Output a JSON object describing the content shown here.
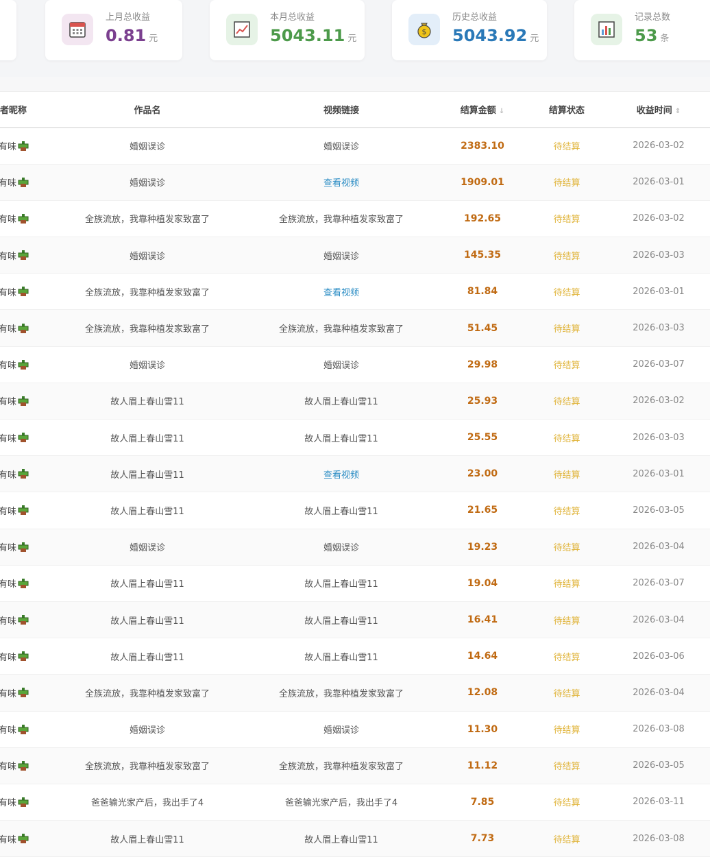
{
  "stats": [
    {
      "label": "上月总收益",
      "value": "0.81",
      "unit": "元",
      "color": "#7b3f8f",
      "icon": "calendar-icon",
      "icon_bg": "#f3e6f1"
    },
    {
      "label": "本月总收益",
      "value": "5043.11",
      "unit": "元",
      "color": "#4c9a4a",
      "icon": "trend-chart-icon",
      "icon_bg": "#e6f3e6"
    },
    {
      "label": "历史总收益",
      "value": "5043.92",
      "unit": "元",
      "color": "#2a79b8",
      "icon": "money-bag-icon",
      "icon_bg": "#e3eef9"
    },
    {
      "label": "记录总数",
      "value": "53",
      "unit": "条",
      "color": "#4c9a4a",
      "icon": "bar-chart-icon",
      "icon_bg": "#e6f3e6"
    }
  ],
  "table": {
    "headers": {
      "nickname": "者昵称",
      "work": "作品名",
      "video": "视频链接",
      "amount": "结算金额",
      "amount_sort": "↓",
      "status": "结算状态",
      "time": "收益时间",
      "time_sort": "⇕"
    },
    "rows": [
      {
        "nick": "有味",
        "work": "婚姻误诊",
        "video": "婚姻误诊",
        "video_is_link": false,
        "amount": "2383.10",
        "status": "待结算",
        "date": "2026-03-02"
      },
      {
        "nick": "有味",
        "work": "婚姻误诊",
        "video": "查看视频",
        "video_is_link": true,
        "amount": "1909.01",
        "status": "待结算",
        "date": "2026-03-01"
      },
      {
        "nick": "有味",
        "work": "全族流放，我靠种植发家致富了",
        "video": "全族流放，我靠种植发家致富了",
        "video_is_link": false,
        "amount": "192.65",
        "status": "待结算",
        "date": "2026-03-02"
      },
      {
        "nick": "有味",
        "work": "婚姻误诊",
        "video": "婚姻误诊",
        "video_is_link": false,
        "amount": "145.35",
        "status": "待结算",
        "date": "2026-03-03"
      },
      {
        "nick": "有味",
        "work": "全族流放，我靠种植发家致富了",
        "video": "查看视频",
        "video_is_link": true,
        "amount": "81.84",
        "status": "待结算",
        "date": "2026-03-01"
      },
      {
        "nick": "有味",
        "work": "全族流放，我靠种植发家致富了",
        "video": "全族流放，我靠种植发家致富了",
        "video_is_link": false,
        "amount": "51.45",
        "status": "待结算",
        "date": "2026-03-03"
      },
      {
        "nick": "有味",
        "work": "婚姻误诊",
        "video": "婚姻误诊",
        "video_is_link": false,
        "amount": "29.98",
        "status": "待结算",
        "date": "2026-03-07"
      },
      {
        "nick": "有味",
        "work": "故人眉上春山雪11",
        "video": "故人眉上春山雪11",
        "video_is_link": false,
        "amount": "25.93",
        "status": "待结算",
        "date": "2026-03-02"
      },
      {
        "nick": "有味",
        "work": "故人眉上春山雪11",
        "video": "故人眉上春山雪11",
        "video_is_link": false,
        "amount": "25.55",
        "status": "待结算",
        "date": "2026-03-03"
      },
      {
        "nick": "有味",
        "work": "故人眉上春山雪11",
        "video": "查看视频",
        "video_is_link": true,
        "amount": "23.00",
        "status": "待结算",
        "date": "2026-03-01"
      },
      {
        "nick": "有味",
        "work": "故人眉上春山雪11",
        "video": "故人眉上春山雪11",
        "video_is_link": false,
        "amount": "21.65",
        "status": "待结算",
        "date": "2026-03-05"
      },
      {
        "nick": "有味",
        "work": "婚姻误诊",
        "video": "婚姻误诊",
        "video_is_link": false,
        "amount": "19.23",
        "status": "待结算",
        "date": "2026-03-04"
      },
      {
        "nick": "有味",
        "work": "故人眉上春山雪11",
        "video": "故人眉上春山雪11",
        "video_is_link": false,
        "amount": "19.04",
        "status": "待结算",
        "date": "2026-03-07"
      },
      {
        "nick": "有味",
        "work": "故人眉上春山雪11",
        "video": "故人眉上春山雪11",
        "video_is_link": false,
        "amount": "16.41",
        "status": "待结算",
        "date": "2026-03-04"
      },
      {
        "nick": "有味",
        "work": "故人眉上春山雪11",
        "video": "故人眉上春山雪11",
        "video_is_link": false,
        "amount": "14.64",
        "status": "待结算",
        "date": "2026-03-06"
      },
      {
        "nick": "有味",
        "work": "全族流放，我靠种植发家致富了",
        "video": "全族流放，我靠种植发家致富了",
        "video_is_link": false,
        "amount": "12.08",
        "status": "待结算",
        "date": "2026-03-04"
      },
      {
        "nick": "有味",
        "work": "婚姻误诊",
        "video": "婚姻误诊",
        "video_is_link": false,
        "amount": "11.30",
        "status": "待结算",
        "date": "2026-03-08"
      },
      {
        "nick": "有味",
        "work": "全族流放，我靠种植发家致富了",
        "video": "全族流放，我靠种植发家致富了",
        "video_is_link": false,
        "amount": "11.12",
        "status": "待结算",
        "date": "2026-03-05"
      },
      {
        "nick": "有味",
        "work": "爸爸输光家产后，我出手了4",
        "video": "爸爸输光家产后，我出手了4",
        "video_is_link": false,
        "amount": "7.85",
        "status": "待结算",
        "date": "2026-03-11"
      },
      {
        "nick": "有味",
        "work": "故人眉上春山雪11",
        "video": "故人眉上春山雪11",
        "video_is_link": false,
        "amount": "7.73",
        "status": "待结算",
        "date": "2026-03-08"
      }
    ]
  }
}
